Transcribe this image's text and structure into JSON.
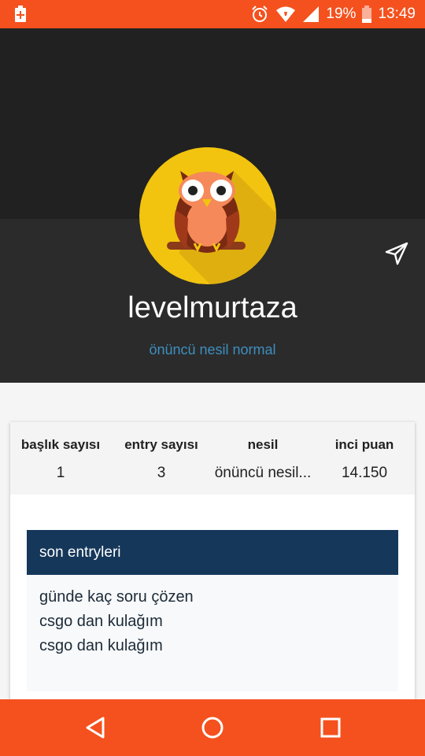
{
  "status_bar": {
    "battery_percent": "19%",
    "time": "13:49",
    "icons": [
      "battery-plus-icon",
      "alarm-icon",
      "wifi-icon",
      "signal-icon",
      "battery-icon"
    ],
    "color": "#f4511e"
  },
  "profile": {
    "username": "levelmurtaza",
    "generation_label": "önüncü nesil normal",
    "avatar_icon": "owl-icon",
    "share_icon": "send-icon"
  },
  "stats": [
    {
      "label": "başlık sayısı",
      "value": "1"
    },
    {
      "label": "entry sayısı",
      "value": "3"
    },
    {
      "label": "nesil",
      "value": "önüncü nesil..."
    },
    {
      "label": "inci puan",
      "value": "14.150"
    }
  ],
  "recent_entries": {
    "title": "son entryleri",
    "items": [
      "günde kaç soru çözen",
      "csgo dan kulağım",
      "csgo dan kulağım"
    ]
  },
  "nav_bar": {
    "buttons": [
      "back-icon",
      "home-icon",
      "recents-icon"
    ],
    "color": "#f4511e"
  },
  "colors": {
    "accent": "#f4511e",
    "header_dark": "#212121",
    "link_blue": "#3d8fbf",
    "entries_header": "#15375a"
  }
}
